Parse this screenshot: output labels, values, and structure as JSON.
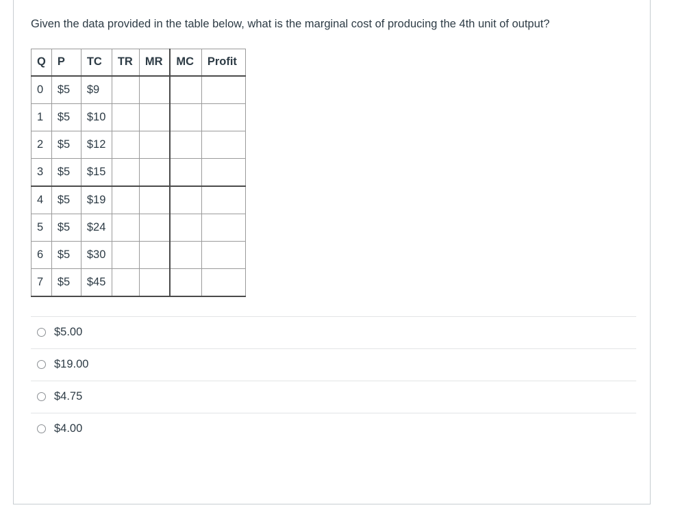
{
  "question": {
    "prompt": "Given the data provided in the table below, what is the marginal cost of producing the 4th unit of output?"
  },
  "table": {
    "headers": [
      "Q",
      "P",
      "TC",
      "TR",
      "MR",
      "MC",
      "Profit"
    ],
    "rows": [
      {
        "q": "0",
        "p": "$5",
        "tc": "$9",
        "tr": "",
        "mr": "",
        "mc": "",
        "profit": ""
      },
      {
        "q": "1",
        "p": "$5",
        "tc": "$10",
        "tr": "",
        "mr": "",
        "mc": "",
        "profit": ""
      },
      {
        "q": "2",
        "p": "$5",
        "tc": "$12",
        "tr": "",
        "mr": "",
        "mc": "",
        "profit": ""
      },
      {
        "q": "3",
        "p": "$5",
        "tc": "$15",
        "tr": "",
        "mr": "",
        "mc": "",
        "profit": ""
      },
      {
        "q": "4",
        "p": "$5",
        "tc": "$19",
        "tr": "",
        "mr": "",
        "mc": "",
        "profit": ""
      },
      {
        "q": "5",
        "p": "$5",
        "tc": "$24",
        "tr": "",
        "mr": "",
        "mc": "",
        "profit": ""
      },
      {
        "q": "6",
        "p": "$5",
        "tc": "$30",
        "tr": "",
        "mr": "",
        "mc": "",
        "profit": ""
      },
      {
        "q": "7",
        "p": "$5",
        "tc": "$45",
        "tr": "",
        "mr": "",
        "mc": "",
        "profit": ""
      }
    ]
  },
  "answers": {
    "options": [
      {
        "label": "$5.00",
        "selected": false
      },
      {
        "label": "$19.00",
        "selected": false
      },
      {
        "label": "$4.75",
        "selected": false
      },
      {
        "label": "$4.00",
        "selected": false
      }
    ]
  },
  "colors": {
    "text": "#2d3b45",
    "panel_border": "#c7cdd1",
    "table_line": "#9a9a9a",
    "table_rule_strong": "#4a4a4a",
    "option_divider": "#e2e4e6",
    "radio_border": "#8b8f93"
  }
}
